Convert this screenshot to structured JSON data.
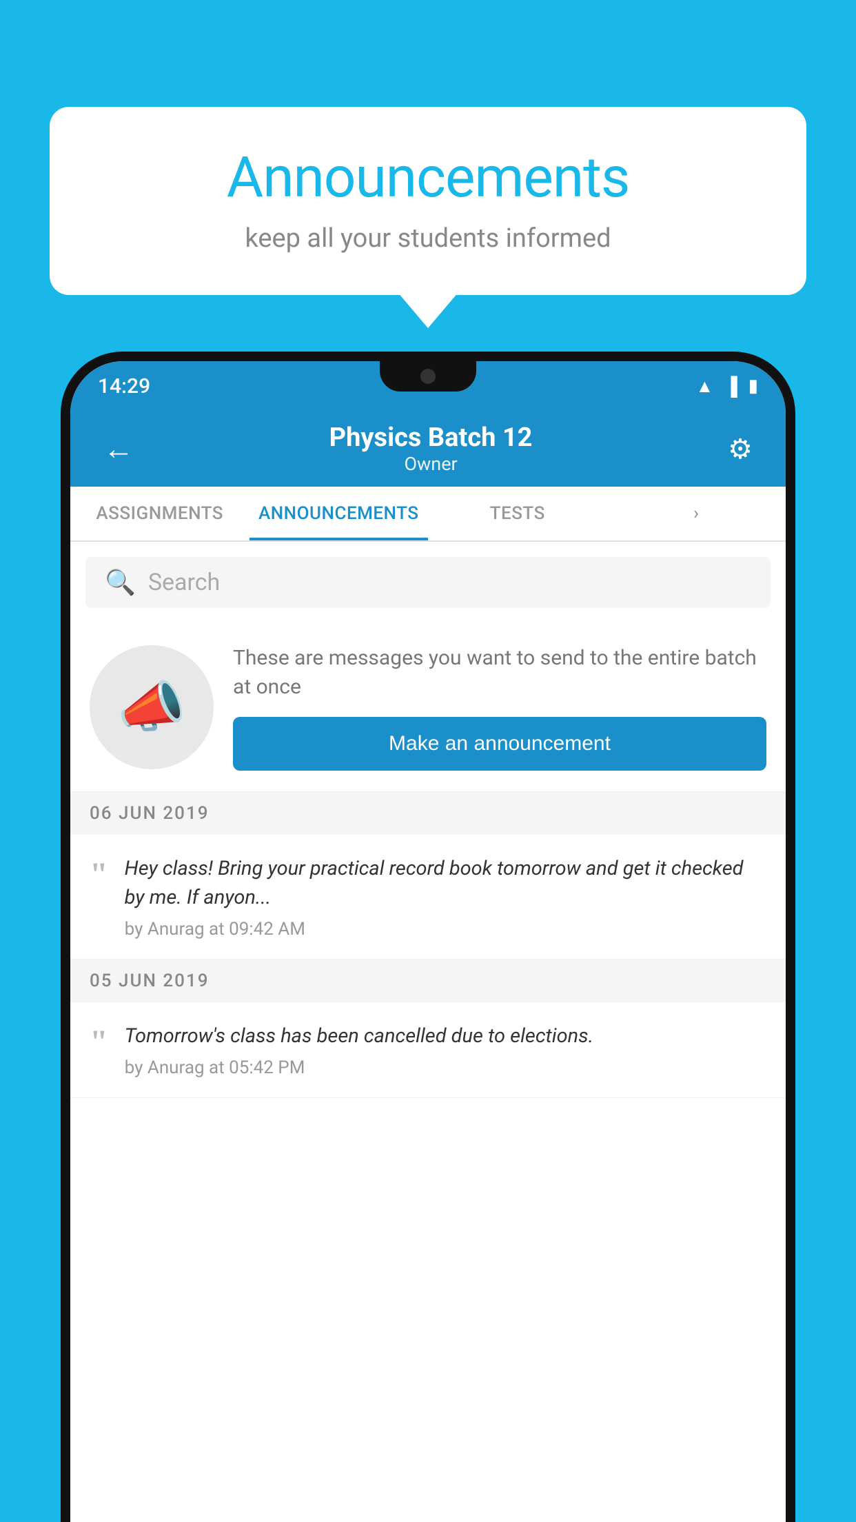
{
  "background_color": "#1ab8e8",
  "speech_bubble": {
    "title": "Announcements",
    "subtitle": "keep all your students informed"
  },
  "phone": {
    "status_bar": {
      "time": "14:29",
      "icons": [
        "wifi",
        "signal",
        "battery"
      ]
    },
    "app_bar": {
      "title": "Physics Batch 12",
      "subtitle": "Owner",
      "back_label": "←",
      "settings_label": "⚙"
    },
    "tabs": [
      {
        "label": "ASSIGNMENTS",
        "active": false
      },
      {
        "label": "ANNOUNCEMENTS",
        "active": true
      },
      {
        "label": "TESTS",
        "active": false
      },
      {
        "label": "...",
        "active": false
      }
    ],
    "search": {
      "placeholder": "Search"
    },
    "promo_section": {
      "description": "These are messages you want to send to the entire batch at once",
      "button_label": "Make an announcement"
    },
    "announcements": [
      {
        "date": "06  JUN  2019",
        "text": "Hey class! Bring your practical record book tomorrow and get it checked by me. If anyon...",
        "meta": "by Anurag at 09:42 AM"
      },
      {
        "date": "05  JUN  2019",
        "text": "Tomorrow's class has been cancelled due to elections.",
        "meta": "by Anurag at 05:42 PM"
      }
    ]
  }
}
